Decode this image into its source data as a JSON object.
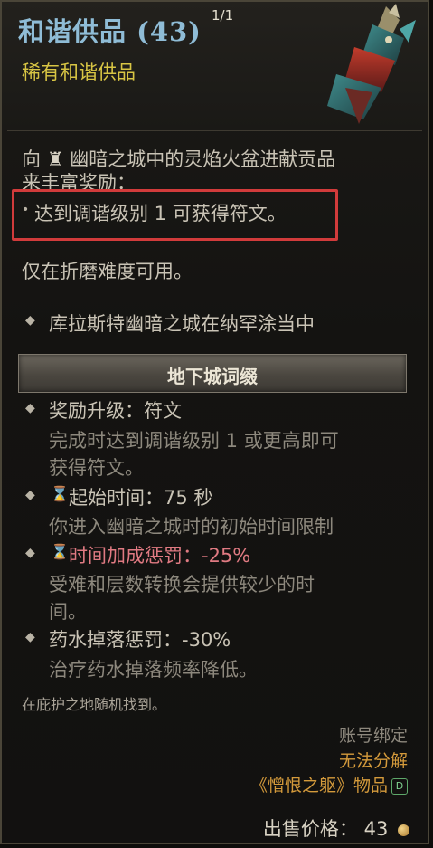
{
  "item": {
    "title": "和谐供品 (43)",
    "stack": "1/1",
    "subtitle": "稀有和谐供品"
  },
  "description": {
    "line1_prefix": "向",
    "line1_rest": "幽暗之城中的灵焰火盆进献贡品",
    "line2": "来丰富奖励：",
    "highlight": "达到调谐级别 1 可获得符文。",
    "torment": "仅在折磨难度可用。",
    "location": "库拉斯特幽暗之城在纳罕涂当中"
  },
  "affixes": {
    "banner": "地下城词缀",
    "reward_title": "奖励升级：符文",
    "reward_desc1": "完成时达到调谐级别 1 或更高即可",
    "reward_desc2": "获得符文。",
    "start_title": "起始时间：75 秒",
    "start_desc": "你进入幽暗之城时的初始时间限制",
    "penalty_title": "时间加成惩罚：-25%",
    "penalty_desc1": "受难和层数转换会提供较少的时",
    "penalty_desc2": "间。",
    "potion_title": "药水掉落惩罚：-30%",
    "potion_desc": "治疗药水掉落频率降低。"
  },
  "footer": {
    "found": "在庇护之地随机找到。",
    "bound": "账号绑定",
    "salvage": "无法分解",
    "expansion": "《憎恨之躯》物品",
    "expansion_badge": "D",
    "sell_label": "出售价格：",
    "sell_value": "43"
  },
  "colors": {
    "title": "#8fbcd6",
    "subtitle": "#d8c544",
    "penalty": "#e07a82",
    "salvage": "#d49a3b",
    "highlight_box": "#d13b3b"
  }
}
